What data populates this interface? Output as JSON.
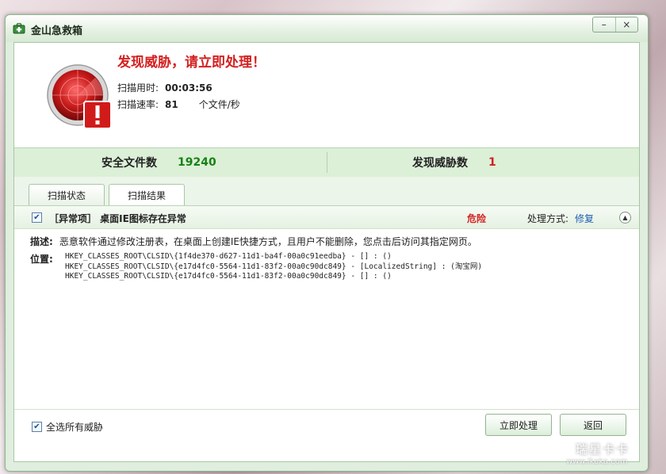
{
  "window": {
    "title": "金山急救箱"
  },
  "title_controls": {
    "minimize": "–",
    "close": "×"
  },
  "scan": {
    "headline": "发现威胁，请立即处理！",
    "time_label": "扫描用时:",
    "time_value": "00:03:56",
    "speed_label": "扫描速率:",
    "speed_value": "81",
    "speed_unit": "个文件/秒"
  },
  "stats": {
    "safe_label": "安全文件数",
    "safe_value": "19240",
    "threat_label": "发现威胁数",
    "threat_value": "1"
  },
  "tabs": [
    {
      "label": "扫描状态"
    },
    {
      "label": "扫描结果"
    }
  ],
  "issue": {
    "checked": true,
    "title": "［异常项］ 桌面IE图标存在异常",
    "level": "危险",
    "method_label": "处理方式:",
    "method_value": "修复",
    "description_label": "描述:",
    "description": "恶意软件通过修改注册表，在桌面上创建IE快捷方式，且用户不能删除，您点击后访问其指定网页。",
    "location_label": "位置:",
    "locations": [
      "HKEY_CLASSES_ROOT\\CLSID\\{1f4de370-d627-11d1-ba4f-00a0c91eedba} - [] : ()",
      "HKEY_CLASSES_ROOT\\CLSID\\{e17d4fc0-5564-11d1-83f2-00a0c90dc849} - [LocalizedString] : (淘宝网)",
      "HKEY_CLASSES_ROOT\\CLSID\\{e17d4fc0-5564-11d1-83f2-00a0c90dc849} - [] : ()"
    ]
  },
  "footer": {
    "select_all_checked": true,
    "select_all_label": "全选所有威胁",
    "handle_button": "立即处理",
    "back_button": "返回"
  },
  "watermark": {
    "brand": "瑞星卡卡",
    "url": "www.ikaka.com"
  },
  "colors": {
    "danger": "#d42020",
    "safe": "#168216",
    "link": "#1f5fb3",
    "accent_green": "#dcefd7"
  },
  "icons": [
    "first-aid-kit-icon",
    "radar-alert-icon",
    "checkbox-checked-icon",
    "collapse-up-icon"
  ]
}
